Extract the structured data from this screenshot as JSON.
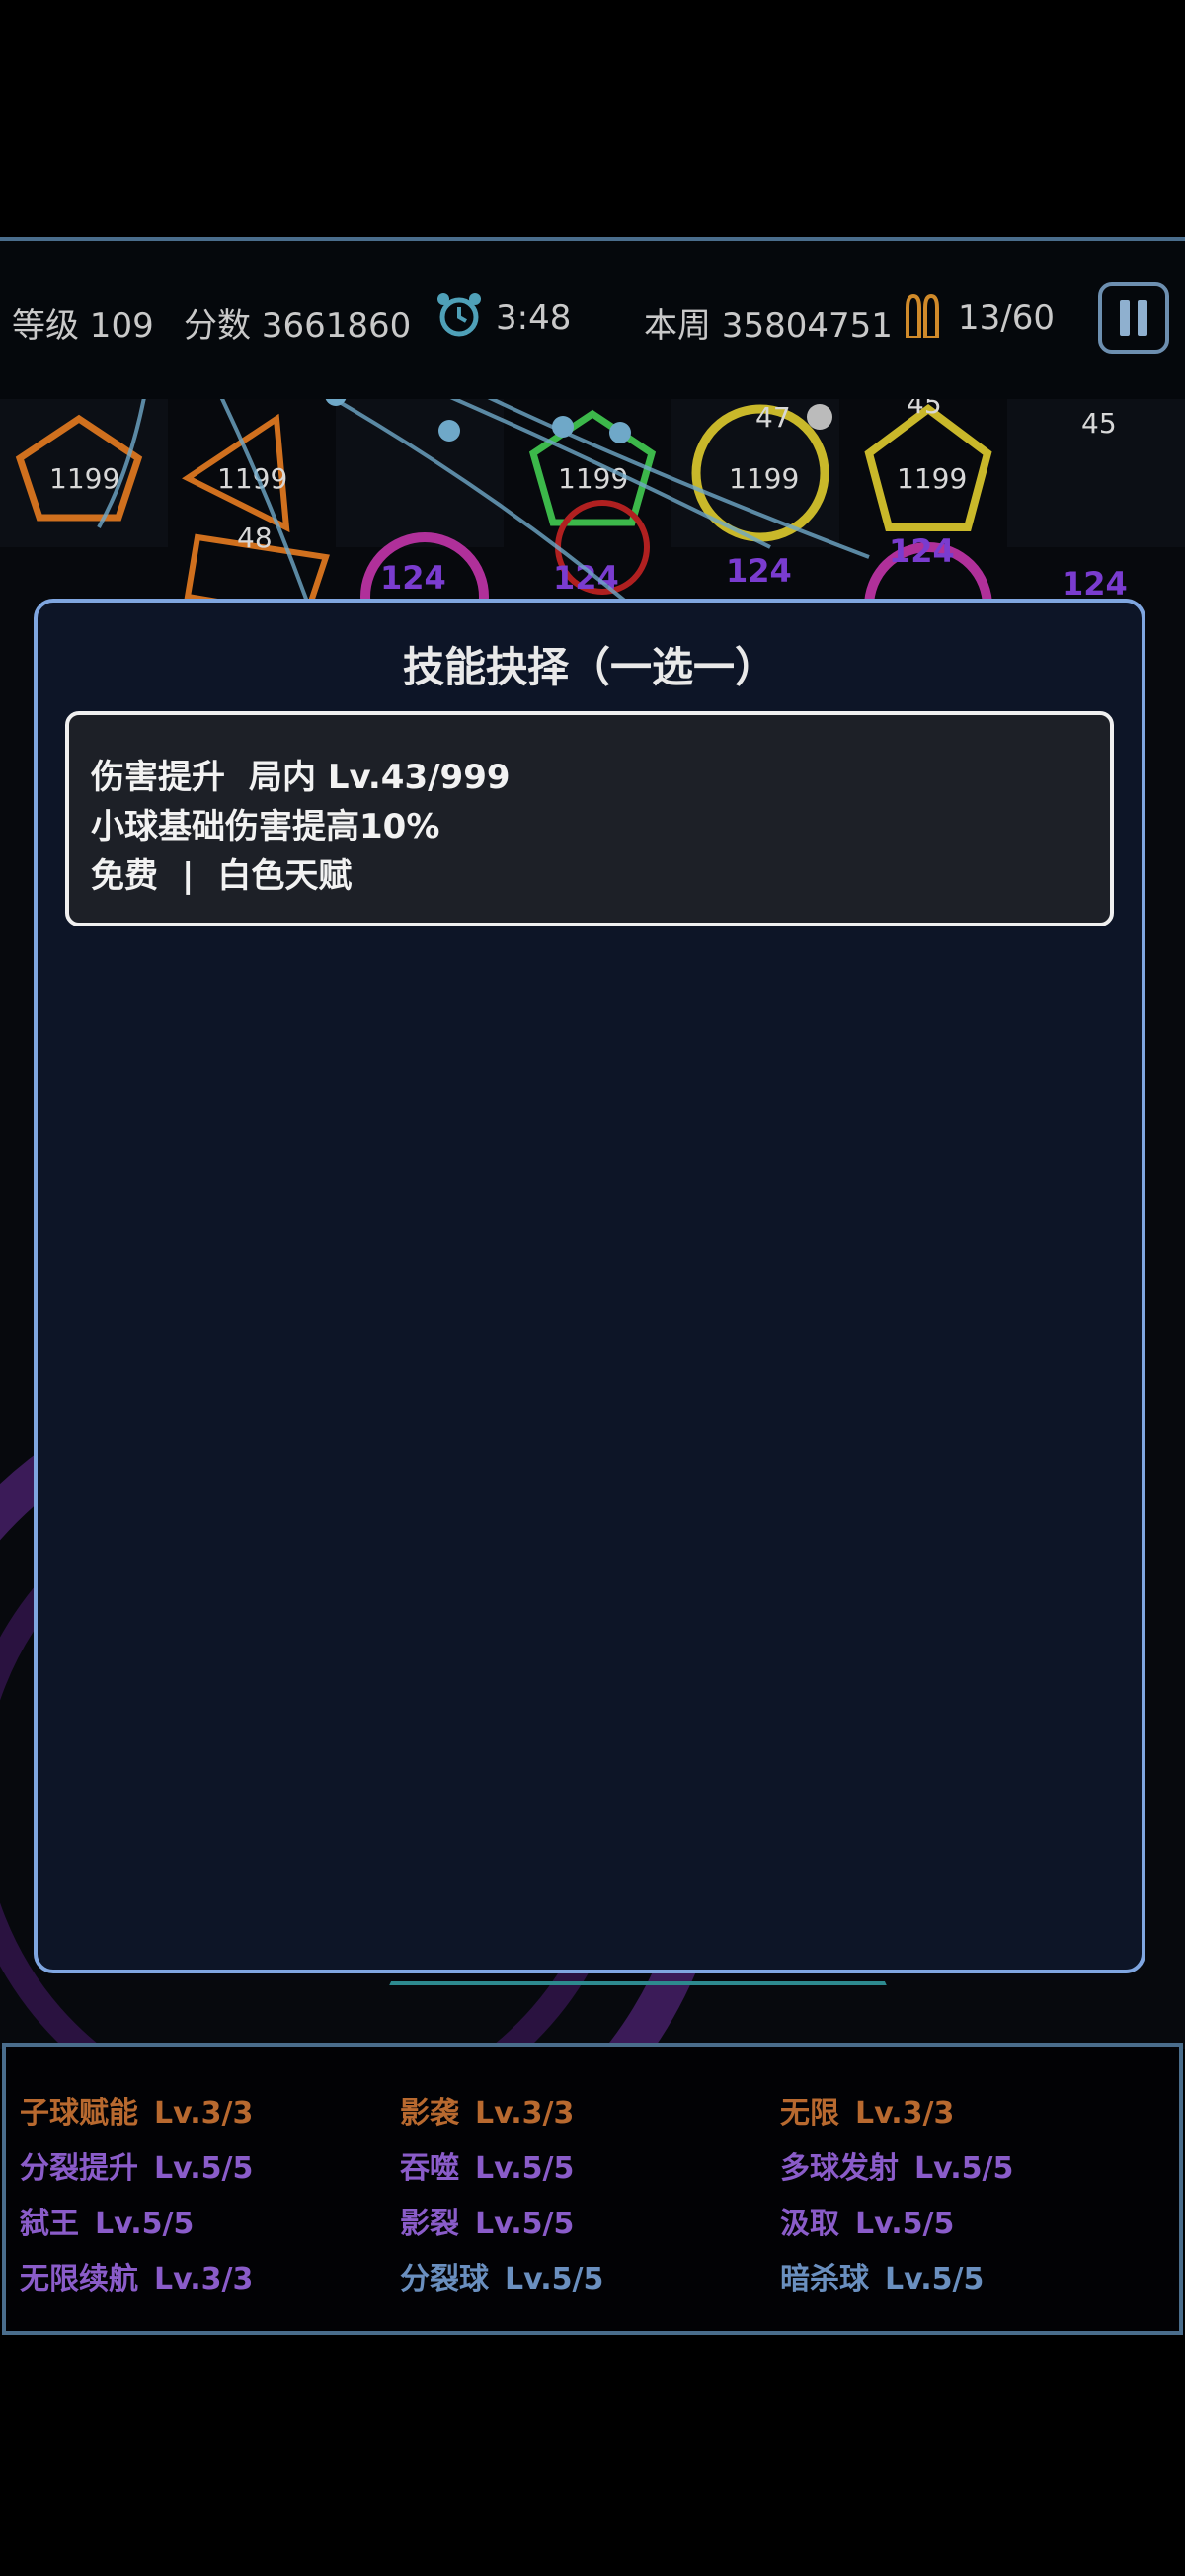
{
  "topbar": {
    "level": "等级 109",
    "score": "分数 3661860",
    "timer": "3:48",
    "weekly": "本周 35804751",
    "ammo": "13/60"
  },
  "playfield": {
    "block_values": [
      "1199",
      "1199",
      "1199",
      "1199",
      "1199",
      "124",
      "124",
      "124",
      "124",
      "124",
      "48",
      "47",
      "45",
      "45"
    ],
    "overlay_text": "complete"
  },
  "modal": {
    "title": "技能抉择（一选一）",
    "card": {
      "name": "伤害提升",
      "level": "局内 Lv.43/999",
      "description": "小球基础伤害提高10%",
      "cost": "免费",
      "separator": "|",
      "talent": "白色天赋"
    }
  },
  "owned_skills": [
    {
      "name": "子球赋能",
      "level": "Lv.3/3",
      "color": "#b8692f"
    },
    {
      "name": "影袭",
      "level": "Lv.3/3",
      "color": "#b8692f"
    },
    {
      "name": "无限",
      "level": "Lv.3/3",
      "color": "#b8692f"
    },
    {
      "name": "分裂提升",
      "level": "Lv.5/5",
      "color": "#8a5cc9"
    },
    {
      "name": "吞噬",
      "level": "Lv.5/5",
      "color": "#8a5cc9"
    },
    {
      "name": "多球发射",
      "level": "Lv.5/5",
      "color": "#8a5cc9"
    },
    {
      "name": "弑王",
      "level": "Lv.5/5",
      "color": "#8a5cc9"
    },
    {
      "name": "影裂",
      "level": "Lv.5/5",
      "color": "#8a5cc9"
    },
    {
      "name": "汲取",
      "level": "Lv.5/5",
      "color": "#8a5cc9"
    },
    {
      "name": "无限续航",
      "level": "Lv.3/3",
      "color": "#8a5cc9"
    },
    {
      "name": "分裂球",
      "level": "Lv.5/5",
      "color": "#6a8fbf"
    },
    {
      "name": "暗杀球",
      "level": "Lv.5/5",
      "color": "#6a8fbf"
    }
  ]
}
